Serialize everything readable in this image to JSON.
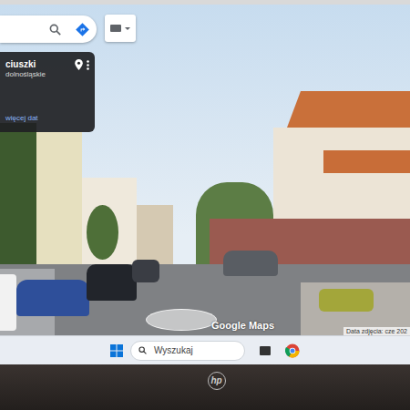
{
  "place_card": {
    "title": "ciuszki",
    "subtitle": "dolnośląskie",
    "link": "więcej dat"
  },
  "watermark": "Google Maps",
  "photo_date": "Data zdjęcia: cze 202",
  "taskbar": {
    "search": "Wyszukaj"
  },
  "laptop": {
    "logo": "hp"
  }
}
